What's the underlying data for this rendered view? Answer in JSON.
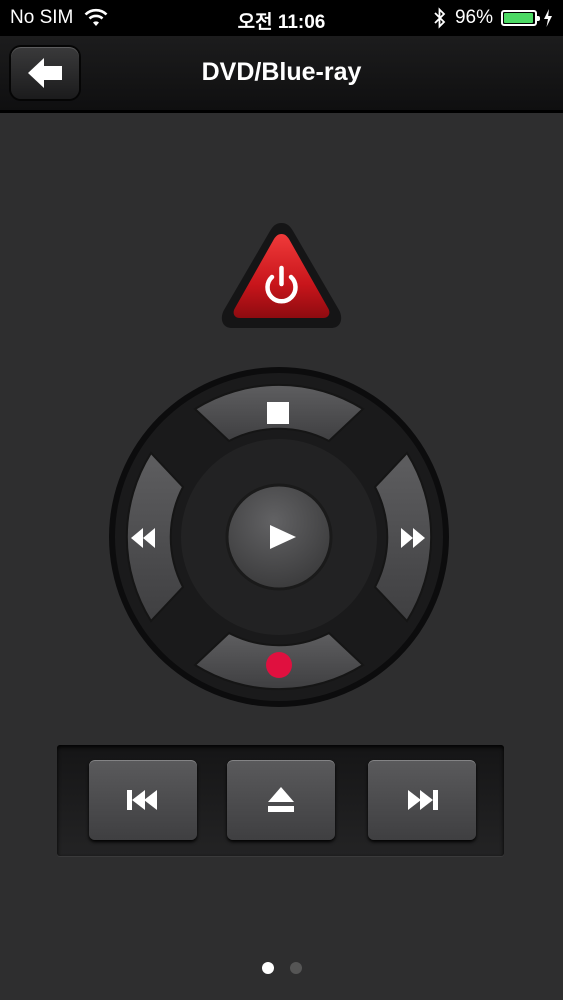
{
  "status_bar": {
    "carrier": "No SIM",
    "time": "오전 11:06",
    "battery_percent": "96%",
    "battery_level": 0.96,
    "icons": [
      "wifi-icon",
      "bluetooth-icon",
      "battery-icon",
      "charging-icon"
    ]
  },
  "nav": {
    "title": "DVD/Blue-ray",
    "back_icon": "back-arrow-icon"
  },
  "remote": {
    "power_icon": "power-icon",
    "dpad": {
      "up_icon": "stop-icon",
      "left_icon": "rewind-icon",
      "center_icon": "play-icon",
      "right_icon": "fast-forward-icon",
      "down_icon": "record-icon"
    },
    "transport": [
      "skip-previous-icon",
      "eject-icon",
      "skip-next-icon"
    ]
  },
  "page_indicator": {
    "pages": 2,
    "current": 1
  },
  "colors": {
    "background": "#2e2e2f",
    "power_red": "#c8151b",
    "record_red": "#e0103f",
    "battery_green": "#4cd964"
  }
}
